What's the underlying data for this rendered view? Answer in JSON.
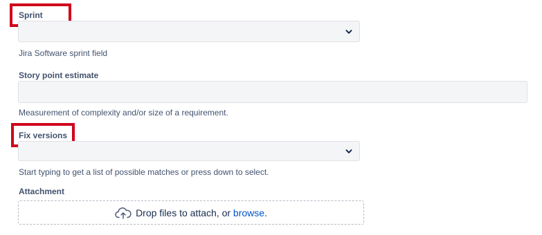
{
  "sprint": {
    "label": "Sprint",
    "value": "",
    "help": "Jira Software sprint field"
  },
  "story_points": {
    "label": "Story point estimate",
    "value": "",
    "help": "Measurement of complexity and/or size of a requirement."
  },
  "fix_versions": {
    "label": "Fix versions",
    "value": "",
    "help": "Start typing to get a list of possible matches or press down to select."
  },
  "attachment": {
    "label": "Attachment",
    "drop_text": "Drop files to attach, or ",
    "browse_link": "browse",
    "period": "."
  },
  "colors": {
    "highlight": "#d0021b",
    "link": "#0052cc",
    "field_bg": "#f4f5f7"
  },
  "icons": [
    "chevron-down-icon",
    "cloud-upload-icon"
  ]
}
